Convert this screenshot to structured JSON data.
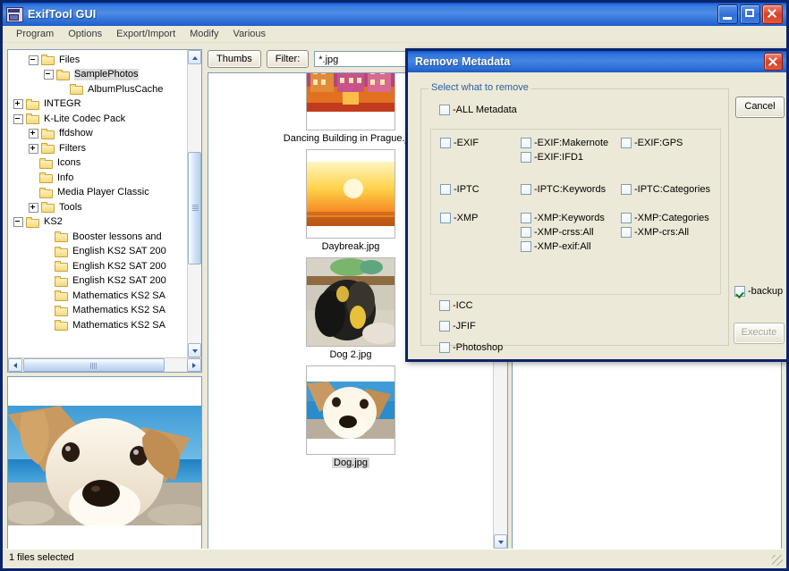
{
  "window": {
    "title": "ExifTool GUI",
    "icon": "app-icon",
    "buttons": {
      "minimize": "minimize",
      "maximize": "maximize",
      "close": "close"
    }
  },
  "menubar": {
    "items": [
      {
        "label": "Program"
      },
      {
        "label": "Options"
      },
      {
        "label": "Export/Import"
      },
      {
        "label": "Modify"
      },
      {
        "label": "Various"
      }
    ]
  },
  "tree": {
    "rows": [
      {
        "indent": 1,
        "toggle": "minus",
        "label": "Files",
        "selected": false
      },
      {
        "indent": 2,
        "toggle": "minus",
        "label": "SamplePhotos",
        "selected": true
      },
      {
        "indent": 3,
        "toggle": "none",
        "label": "AlbumPlusCache",
        "selected": false
      },
      {
        "indent": 0,
        "toggle": "plus",
        "label": "INTEGR",
        "selected": false
      },
      {
        "indent": 0,
        "toggle": "minus",
        "label": "K-Lite Codec Pack",
        "selected": false
      },
      {
        "indent": 1,
        "toggle": "plus",
        "label": "ffdshow",
        "selected": false
      },
      {
        "indent": 1,
        "toggle": "plus",
        "label": "Filters",
        "selected": false
      },
      {
        "indent": 1,
        "toggle": "none",
        "label": "Icons",
        "selected": false
      },
      {
        "indent": 1,
        "toggle": "none",
        "label": "Info",
        "selected": false
      },
      {
        "indent": 1,
        "toggle": "none",
        "label": "Media Player Classic",
        "selected": false
      },
      {
        "indent": 1,
        "toggle": "plus",
        "label": "Tools",
        "selected": false
      },
      {
        "indent": 0,
        "toggle": "minus",
        "label": "KS2",
        "selected": false
      },
      {
        "indent": 2,
        "toggle": "none",
        "label": "Booster lessons and",
        "selected": false
      },
      {
        "indent": 2,
        "toggle": "none",
        "label": "English KS2 SAT 200",
        "selected": false
      },
      {
        "indent": 2,
        "toggle": "none",
        "label": "English KS2 SAT 200",
        "selected": false
      },
      {
        "indent": 2,
        "toggle": "none",
        "label": "English KS2 SAT 200",
        "selected": false
      },
      {
        "indent": 2,
        "toggle": "none",
        "label": "Mathematics KS2 SA",
        "selected": false
      },
      {
        "indent": 2,
        "toggle": "none",
        "label": "Mathematics KS2 SA",
        "selected": false
      },
      {
        "indent": 2,
        "toggle": "none",
        "label": "Mathematics KS2 SA",
        "selected": false
      }
    ]
  },
  "toolbar": {
    "thumbs_label": "Thumbs",
    "filter_label": "Filter:",
    "filter_value": "*.jpg"
  },
  "thumbnails": {
    "items": [
      {
        "caption": "Dancing Building in Prague.jpg",
        "selected": false,
        "art": "prague"
      },
      {
        "caption": "Daybreak.jpg",
        "selected": false,
        "art": "daybreak"
      },
      {
        "caption": "Dog 2.jpg",
        "selected": false,
        "art": "dog2"
      },
      {
        "caption": "Dog.jpg",
        "selected": true,
        "art": "dog"
      }
    ]
  },
  "preview": {
    "image": "dog-beach-photo"
  },
  "statusbar": {
    "text": "1 files selected"
  },
  "dialog": {
    "title": "Remove Metadata",
    "close_icon": "close-icon",
    "group_legend": "Select what to remove",
    "all_metadata": {
      "label": "-ALL Metadata",
      "checked": false
    },
    "columns": {
      "col1": [
        {
          "label": "-EXIF",
          "checked": false
        },
        {
          "label": "-IPTC",
          "checked": false
        },
        {
          "label": "-XMP",
          "checked": false
        }
      ],
      "col2": [
        {
          "label": "-EXIF:Makernote",
          "checked": false
        },
        {
          "label": "-EXIF:IFD1",
          "checked": false
        },
        {
          "label": "-IPTC:Keywords",
          "checked": false
        },
        {
          "label": "-XMP:Keywords",
          "checked": false
        },
        {
          "label": "-XMP-crss:All",
          "checked": false
        },
        {
          "label": "-XMP-exif:All",
          "checked": false
        }
      ],
      "col3": [
        {
          "label": "-EXIF:GPS",
          "checked": false
        },
        {
          "label": "-IPTC:Categories",
          "checked": false
        },
        {
          "label": "-XMP:Categories",
          "checked": false
        },
        {
          "label": "-XMP-crs:All",
          "checked": false
        }
      ],
      "bottom": [
        {
          "label": "-ICC",
          "checked": false
        },
        {
          "label": "-JFIF",
          "checked": false
        },
        {
          "label": "-Photoshop",
          "checked": false
        }
      ]
    },
    "cancel_label": "Cancel",
    "backup": {
      "label": "-backup",
      "checked": true
    },
    "execute": {
      "label": "Execute",
      "enabled": false
    }
  },
  "colors": {
    "title_blue": "#0a246a",
    "face": "#ece9d8",
    "legend_blue": "#2b5f9e",
    "check_green": "#127a21"
  }
}
